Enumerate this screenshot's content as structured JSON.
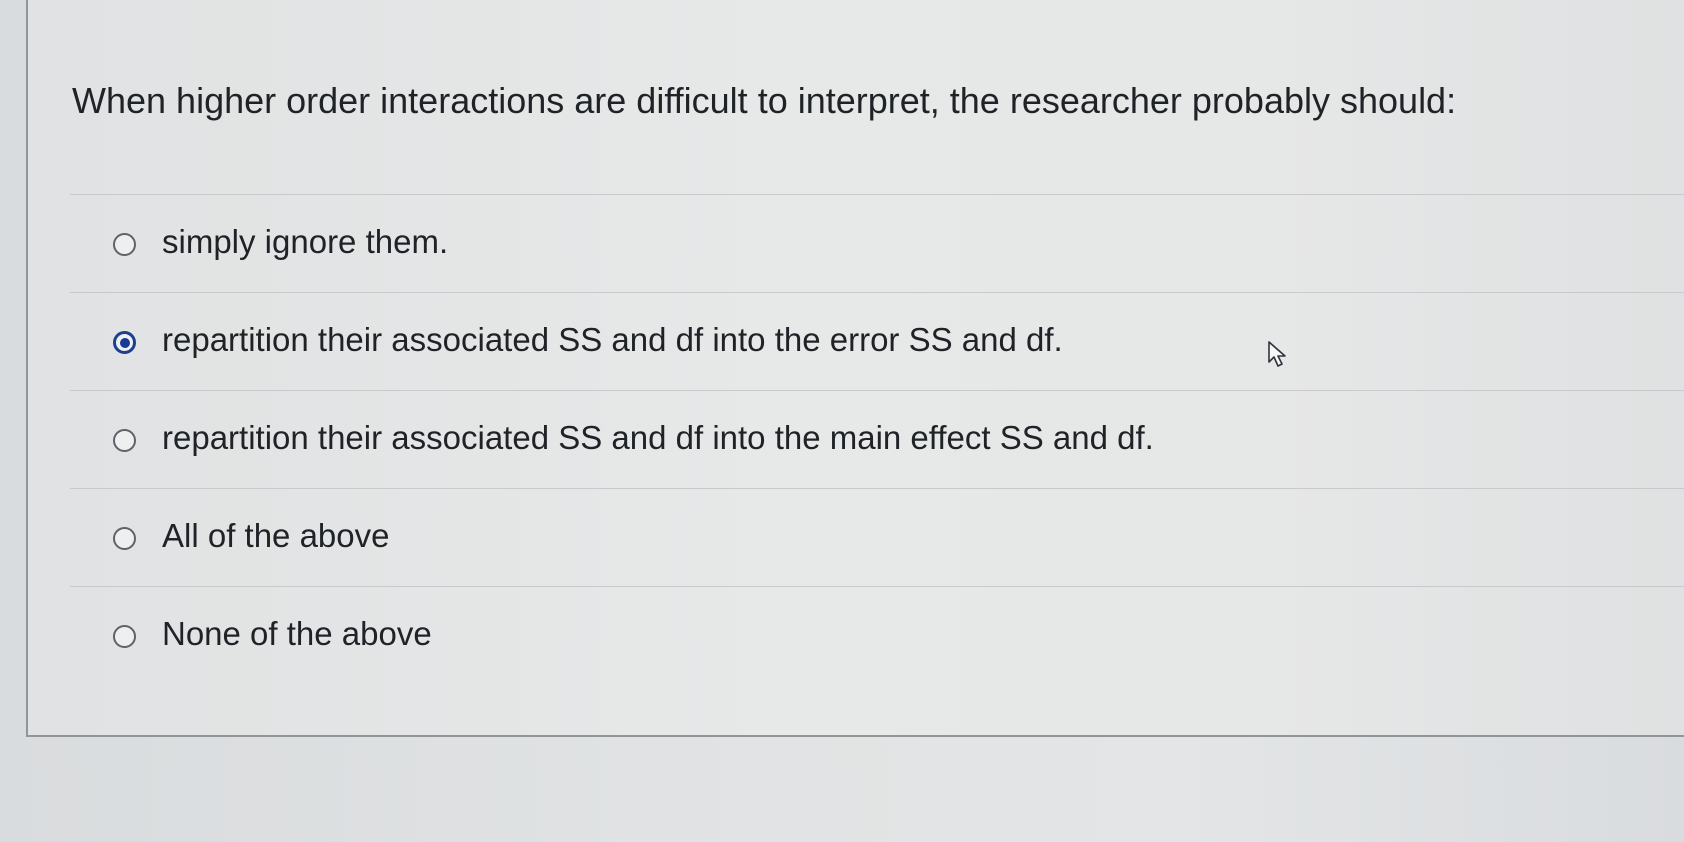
{
  "question": {
    "text": "When higher order interactions are difficult to interpret, the researcher probably should:"
  },
  "answers": [
    {
      "label": "simply ignore them.",
      "selected": false
    },
    {
      "label": "repartition their associated SS and df into the error SS and df.",
      "selected": true
    },
    {
      "label": "repartition their associated SS and df into the main effect SS and df.",
      "selected": false
    },
    {
      "label": "All of the above",
      "selected": false
    },
    {
      "label": "None of the above",
      "selected": false
    }
  ],
  "colors": {
    "selected_radio": "#173b92",
    "text": "#1f2327",
    "divider": "#c6cacc"
  },
  "icons": {
    "cursor": "mouse-pointer-icon"
  }
}
